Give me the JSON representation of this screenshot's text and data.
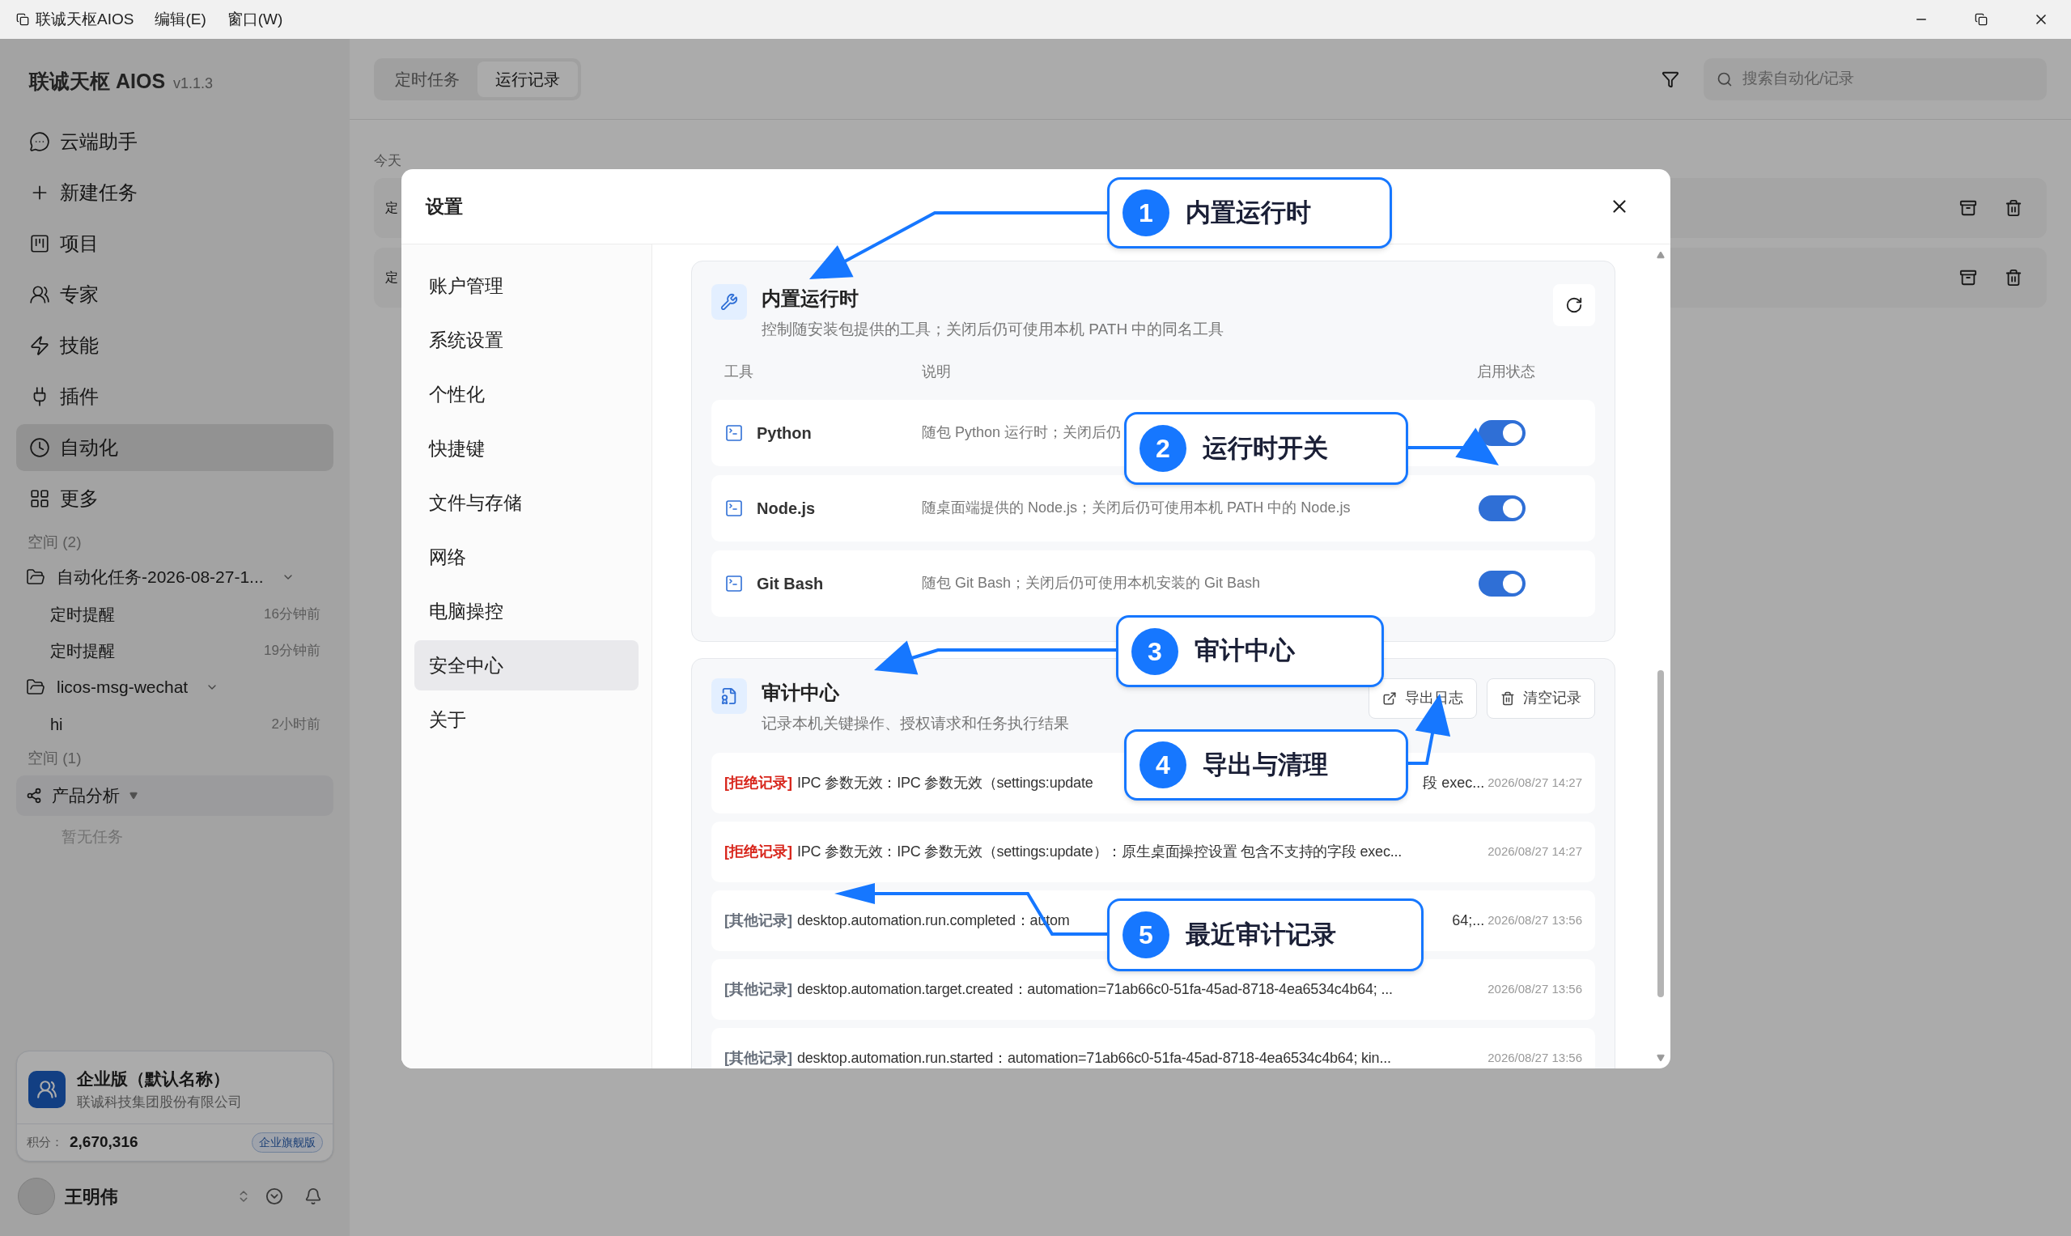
{
  "title_bar": {
    "app_name": "联诚天枢AIOS",
    "menus": [
      "编辑(E)",
      "窗口(W)"
    ]
  },
  "sidebar": {
    "brand": "联诚天枢 AIOS",
    "version": "v1.1.3",
    "nav": [
      {
        "label": "云端助手",
        "selected": false
      },
      {
        "label": "新建任务",
        "selected": false
      },
      {
        "label": "项目",
        "selected": false
      },
      {
        "label": "专家",
        "selected": false
      },
      {
        "label": "技能",
        "selected": false
      },
      {
        "label": "插件",
        "selected": false
      },
      {
        "label": "自动化",
        "selected": true
      },
      {
        "label": "更多",
        "selected": false
      }
    ],
    "spaces": [
      {
        "heading": "空间 (2)",
        "items": [
          {
            "kind": "folder",
            "name": "自动化任务-2026-08-27-1...",
            "expanded": true,
            "tasks": [
              {
                "name": "定时提醒",
                "time": "16分钟前"
              },
              {
                "name": "定时提醒",
                "time": "19分钟前"
              }
            ]
          },
          {
            "kind": "folder",
            "name": "licos-msg-wechat",
            "expanded": true,
            "tasks": [
              {
                "name": "hi",
                "time": "2小时前"
              }
            ]
          }
        ]
      },
      {
        "heading": "空间 (1)",
        "items": [
          {
            "kind": "group",
            "name": "产品分析",
            "expanded": true,
            "empty_text": "暂无任务"
          }
        ]
      }
    ]
  },
  "account_card": {
    "title": "企业版（默认名称）",
    "company": "联诚科技集团股份有限公司",
    "points_label": "积分：",
    "points": "2,670,316",
    "badge": "企业旗舰版"
  },
  "user": {
    "name": "王明伟"
  },
  "main": {
    "tabs": [
      {
        "label": "定时任务",
        "selected": false
      },
      {
        "label": "运行记录",
        "selected": true
      }
    ],
    "search": {
      "placeholder": "搜索自动化/记录"
    },
    "day_label": "今天",
    "rows": [
      {
        "title": "定"
      },
      {
        "title": "定"
      }
    ]
  },
  "settings_dialog": {
    "title": "设置",
    "nav": [
      {
        "label": "账户管理",
        "selected": false
      },
      {
        "label": "系统设置",
        "selected": false
      },
      {
        "label": "个性化",
        "selected": false
      },
      {
        "label": "快捷键",
        "selected": false
      },
      {
        "label": "文件与存储",
        "selected": false
      },
      {
        "label": "网络",
        "selected": false
      },
      {
        "label": "电脑操控",
        "selected": false
      },
      {
        "label": "安全中心",
        "selected": true
      },
      {
        "label": "关于",
        "selected": false
      }
    ],
    "runtime": {
      "title": "内置运行时",
      "subtitle": "控制随安装包提供的工具；关闭后仍可使用本机 PATH 中的同名工具",
      "columns": [
        "工具",
        "说明",
        "启用状态"
      ],
      "tools": [
        {
          "name": "Python",
          "description": "随包 Python 运行时；关闭后仍",
          "on": true
        },
        {
          "name": "Node.js",
          "description": "随桌面端提供的 Node.js；关闭后仍可使用本机 PATH 中的 Node.js",
          "on": true
        },
        {
          "name": "Git Bash",
          "description": "随包 Git Bash；关闭后仍可使用本机安装的 Git Bash",
          "on": true
        }
      ]
    },
    "audit": {
      "title": "审计中心",
      "subtitle": "记录本机关键操作、授权请求和任务执行结果",
      "buttons": [
        "导出日志",
        "清空记录"
      ],
      "records": [
        {
          "kind": "denied",
          "tag": "[拒绝记录]",
          "message": "IPC 参数无效：IPC 参数无效（settings:update",
          "message_tail": "段 exec...",
          "time": "2026/08/27 14:27"
        },
        {
          "kind": "denied",
          "tag": "[拒绝记录]",
          "message": "IPC 参数无效：IPC 参数无效（settings:update）：原生桌面操控设置 包含不支持的字段 exec...",
          "time": "2026/08/27 14:27"
        },
        {
          "kind": "other",
          "tag": "[其他记录]",
          "message": "desktop.automation.run.completed：autom",
          "message_tail": "64;...",
          "time": "2026/08/27 13:56"
        },
        {
          "kind": "other",
          "tag": "[其他记录]",
          "message": "desktop.automation.target.created：automation=71ab66c0-51fa-45ad-8718-4ea6534c4b64; ...",
          "time": "2026/08/27 13:56"
        },
        {
          "kind": "other",
          "tag": "[其他记录]",
          "message": "desktop.automation.run.started：automation=71ab66c0-51fa-45ad-8718-4ea6534c4b64; kin...",
          "time": "2026/08/27 13:56"
        }
      ]
    }
  },
  "callouts": [
    {
      "number": "1",
      "label": "内置运行时"
    },
    {
      "number": "2",
      "label": "运行时开关"
    },
    {
      "number": "3",
      "label": "审计中心"
    },
    {
      "number": "4",
      "label": "导出与清理"
    },
    {
      "number": "5",
      "label": "最近审计记录"
    }
  ]
}
